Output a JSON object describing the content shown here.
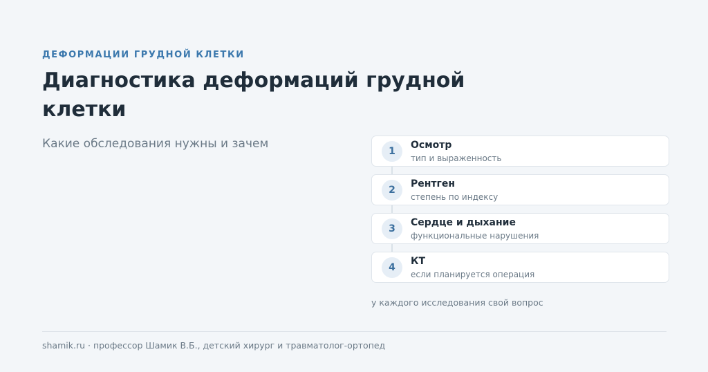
{
  "header": {
    "eyebrow": "ДЕФОРМАЦИИ ГРУДНОЙ КЛЕТКИ",
    "title": "Диагностика деформаций грудной клетки",
    "subtitle": "Какие обследования нужны и зачем"
  },
  "steps": [
    {
      "number": "1",
      "title": "Осмотр",
      "description": "тип и выраженность"
    },
    {
      "number": "2",
      "title": "Рентген",
      "description": "степень по индексу"
    },
    {
      "number": "3",
      "title": "Сердце и дыхание",
      "description": "функциональные нарушения"
    },
    {
      "number": "4",
      "title": "КТ",
      "description": "если планируется операция"
    }
  ],
  "note": "у каждого исследования свой вопрос",
  "footer": {
    "text": "shamik.ru · профессор Шамик В.Б., детский хирург и травматолог-ортопед"
  },
  "colors": {
    "background": "#f3f6f9",
    "accent": "#3b78ad",
    "heading": "#1f2d3a",
    "muted": "#6b7a87",
    "badge_bg": "#e6eef6"
  }
}
